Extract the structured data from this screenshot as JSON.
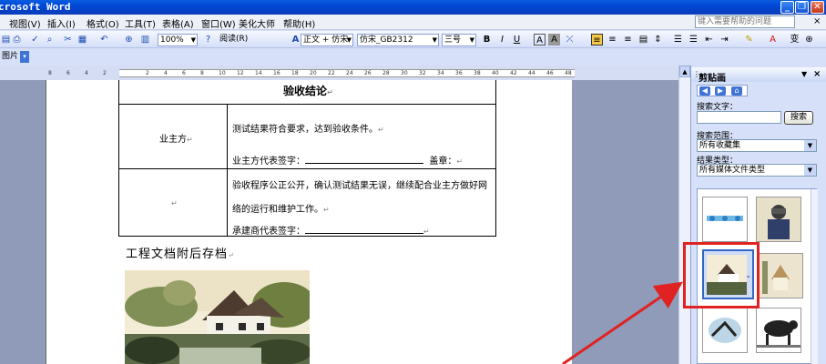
{
  "window": {
    "title": "crosoft Word"
  },
  "menu": {
    "items": [
      "视图(V)",
      "插入(I)",
      "格式(O)",
      "工具(T)",
      "表格(A)",
      "窗口(W)",
      "美化大师",
      "帮助(H)"
    ],
    "help_placeholder": "键入需要帮助的问题",
    "close_glyph": "×"
  },
  "toolbar": {
    "zoom": "100%",
    "reading_button": "阅读(R)",
    "style": "正文 + 仿宋",
    "font": "仿宋_GB2312",
    "font_size": "三号",
    "bold": "B",
    "italic": "I",
    "underline": "U",
    "text_labels": [
      "A",
      "A",
      "变"
    ],
    "picture_toolbar": "图片"
  },
  "ruler": {
    "ticks": [
      "8",
      "6",
      "4",
      "2",
      "2",
      "4",
      "6",
      "8",
      "10",
      "12",
      "14",
      "16",
      "18",
      "20",
      "22",
      "24",
      "26",
      "28",
      "30",
      "32",
      "34",
      "36",
      "38",
      "40",
      "42",
      "44",
      "46",
      "48"
    ]
  },
  "document": {
    "table_title": "验收结论",
    "row1_label": "业主方",
    "row1_line1": "测试结果符合要求，达到验收条件。",
    "row1_sign_label": "业主方代表签字：",
    "row1_seal_label": "盖章：",
    "row2_line1": "验收程序公正公开，确认测试结果无误，继续配合业主方做好网",
    "row2_line2": "络的运行和维护工作。",
    "row2_sign_label": "承建商代表签字：",
    "heading": "工程文档附后存档",
    "para_mark": "↵"
  },
  "taskpane": {
    "title": "剪贴画",
    "search_text_label": "搜索文字：",
    "search_text_value": "",
    "search_button": "搜索",
    "scope_label": "搜索范围：",
    "scope_value": "所有收藏集",
    "result_type_label": "结果类型：",
    "result_type_value": "所有媒体文件类型"
  },
  "colors": {
    "highlight": "#e02222",
    "arrow": "#e02222",
    "titlebar": "#0046d5"
  }
}
